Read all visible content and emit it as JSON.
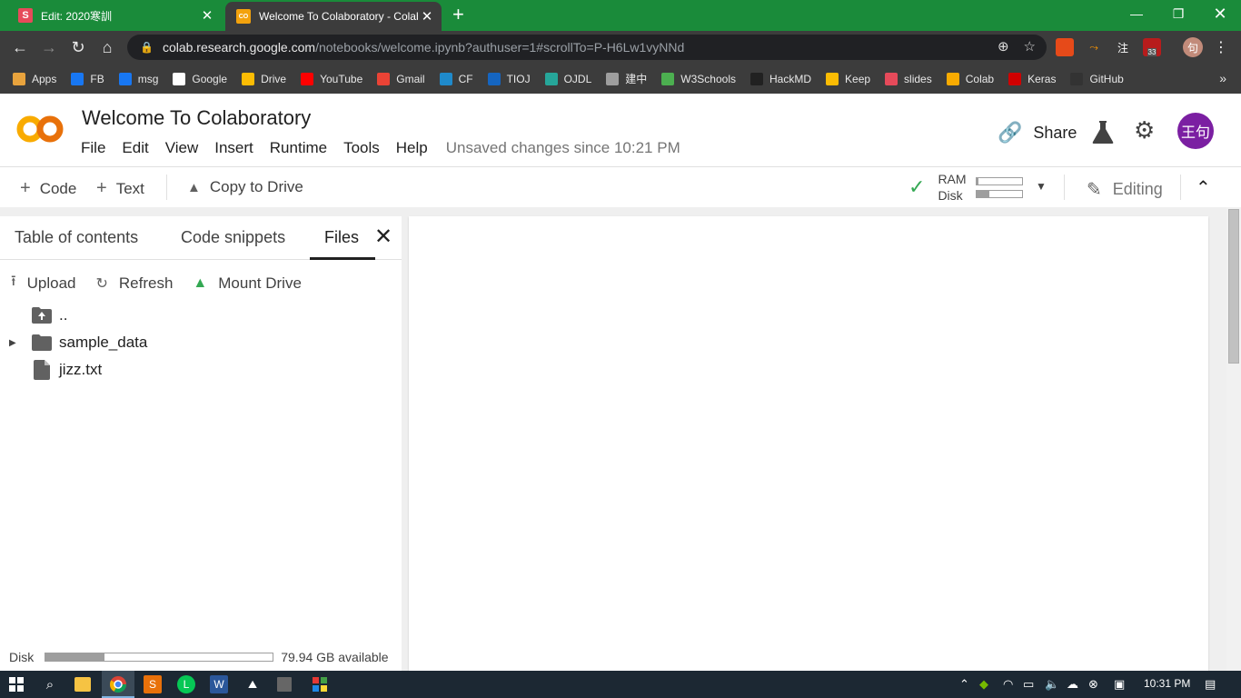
{
  "browser": {
    "tabs": [
      {
        "title": "Edit: 2020寒訓",
        "favicon": "S",
        "active": false
      },
      {
        "title": "Welcome To Colaboratory - Colab",
        "favicon": "CO",
        "active": true
      }
    ],
    "url_host": "colab.research.google.com",
    "url_path": "/notebooks/welcome.ipynb?authuser=1#scrollTo=P-H6Lw1vyNNd",
    "ext_badge": "33",
    "ext_label_zhu": "注",
    "profile_label": "句"
  },
  "bookmarks": [
    {
      "label": "Apps",
      "icon": "apps-grid-icon",
      "color": "#e8a33d"
    },
    {
      "label": "FB",
      "icon": "facebook-icon",
      "color": "#1877f2"
    },
    {
      "label": "msg",
      "icon": "facebook-icon",
      "color": "#1877f2"
    },
    {
      "label": "Google",
      "icon": "google-icon",
      "color": "#ffffff"
    },
    {
      "label": "Drive",
      "icon": "drive-icon",
      "color": "#fbbc04"
    },
    {
      "label": "YouTube",
      "icon": "youtube-icon",
      "color": "#ff0000"
    },
    {
      "label": "Gmail",
      "icon": "gmail-icon",
      "color": "#ea4335"
    },
    {
      "label": "CF",
      "icon": "codeforces-icon",
      "color": "#1f8acb"
    },
    {
      "label": "TIOJ",
      "icon": "tioj-icon",
      "color": "#1565c0"
    },
    {
      "label": "OJDL",
      "icon": "ojdl-icon",
      "color": "#26a69a"
    },
    {
      "label": "建中",
      "icon": "school-icon",
      "color": "#9e9e9e"
    },
    {
      "label": "W3Schools",
      "icon": "w3schools-icon",
      "color": "#4caf50"
    },
    {
      "label": "HackMD",
      "icon": "hackmd-icon",
      "color": "#212121"
    },
    {
      "label": "Keep",
      "icon": "keep-icon",
      "color": "#fbbc04"
    },
    {
      "label": "slides",
      "icon": "slides-icon",
      "color": "#e64a5a"
    },
    {
      "label": "Colab",
      "icon": "colab-icon",
      "color": "#f9ab00"
    },
    {
      "label": "Keras",
      "icon": "keras-icon",
      "color": "#d00000"
    },
    {
      "label": "GitHub",
      "icon": "github-icon",
      "color": "#333333"
    }
  ],
  "colab": {
    "logo_text": "CO",
    "title": "Welcome To Colaboratory",
    "menu": [
      "File",
      "Edit",
      "View",
      "Insert",
      "Runtime",
      "Tools",
      "Help"
    ],
    "unsaved": "Unsaved changes since 10:21 PM",
    "share_label": "Share",
    "avatar_text": "王句",
    "avatar_color": "#7b1fa2",
    "code_label": "Code",
    "text_label": "Text",
    "copy_label": "Copy to Drive",
    "ram_label": "RAM",
    "disk_label": "Disk",
    "ram_fill": 0.04,
    "disk_fill": 0.28,
    "editing_label": "Editing"
  },
  "panel": {
    "tabs": [
      "Table of contents",
      "Code snippets",
      "Files"
    ],
    "active_tab": "Files",
    "actions": [
      {
        "label": "Upload",
        "icon": "upload-icon"
      },
      {
        "label": "Refresh",
        "icon": "refresh-icon"
      },
      {
        "label": "Mount Drive",
        "icon": "drive-icon"
      }
    ],
    "tree": [
      {
        "label": "..",
        "icon": "folder-up-icon",
        "expandable": false
      },
      {
        "label": "sample_data",
        "icon": "folder-icon",
        "expandable": true
      },
      {
        "label": "jizz.txt",
        "icon": "file-icon",
        "expandable": false
      }
    ],
    "disk_label": "Disk",
    "disk_available": "79.94 GB available",
    "disk_fill": 0.26
  },
  "taskbar": {
    "time": "10:31 PM"
  }
}
